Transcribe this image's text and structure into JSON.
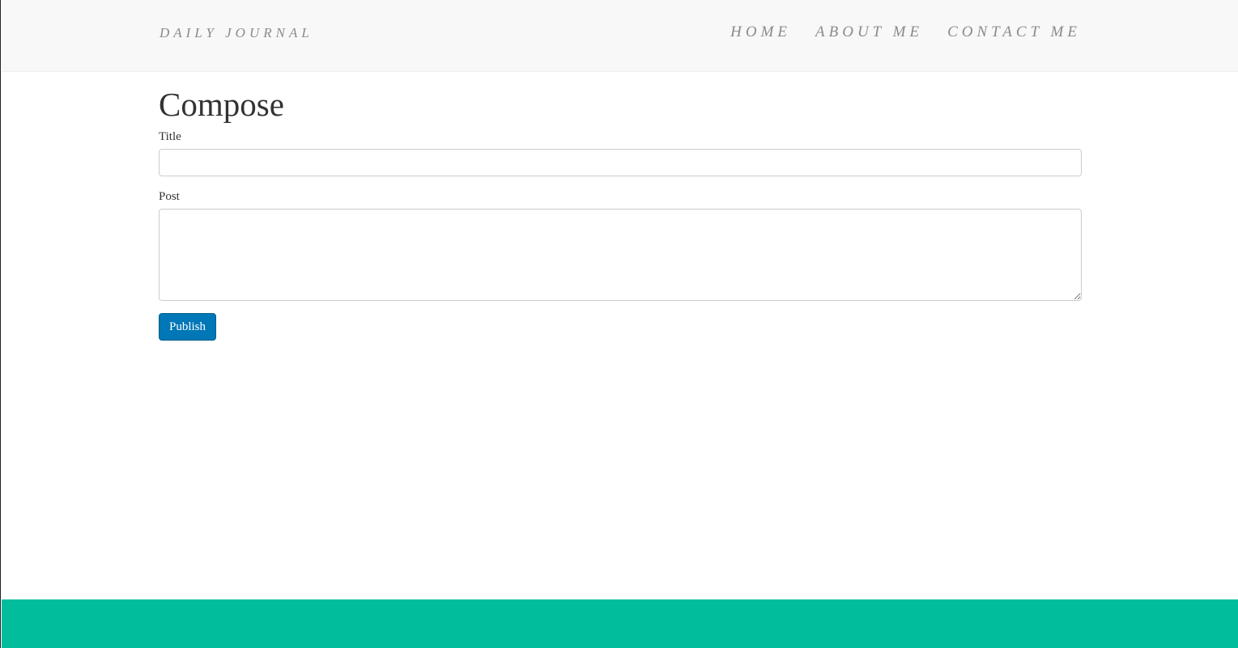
{
  "navbar": {
    "brand": "DAILY JOURNAL",
    "links": [
      {
        "label": "HOME"
      },
      {
        "label": "ABOUT ME"
      },
      {
        "label": "CONTACT ME"
      }
    ]
  },
  "compose": {
    "heading": "Compose",
    "title_label": "Title",
    "title_value": "",
    "post_label": "Post",
    "post_value": "",
    "publish_label": "Publish"
  },
  "colors": {
    "navbar_bg": "#f8f8f8",
    "nav_text": "#8a8a8a",
    "button_bg": "#0077b6",
    "footer_bg": "#01bd9b"
  }
}
